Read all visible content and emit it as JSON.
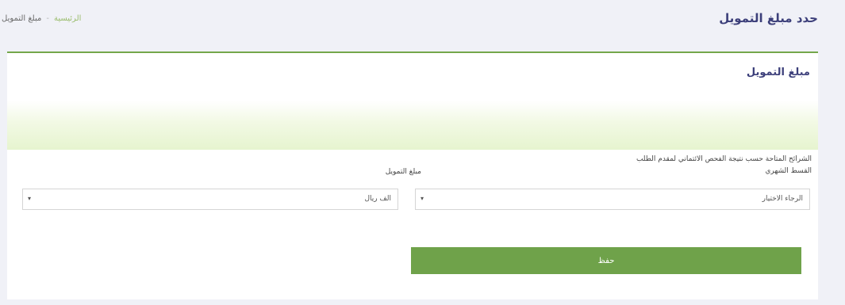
{
  "header": {
    "page_title": "حدد مبلغ التمويل",
    "breadcrumb": {
      "home": "الرئيسية",
      "separator": "-",
      "current": "مبلغ التمويل"
    }
  },
  "card": {
    "title": "مبلغ التمويل",
    "note": "الشرائح المتاحة حسب نتيجة الفحص الائتماني لمقدم الطلب",
    "fields": {
      "installment": {
        "label": "القسط الشهري",
        "value": "الرجاء الاختيار"
      },
      "amount": {
        "label": "مبلغ التمويل",
        "value": "الف ريال"
      }
    },
    "save_label": "حفظ"
  },
  "colors": {
    "accent_green": "#6fa24a",
    "title_blue": "#3c3f7a",
    "band_green": "#e6f4cf"
  }
}
